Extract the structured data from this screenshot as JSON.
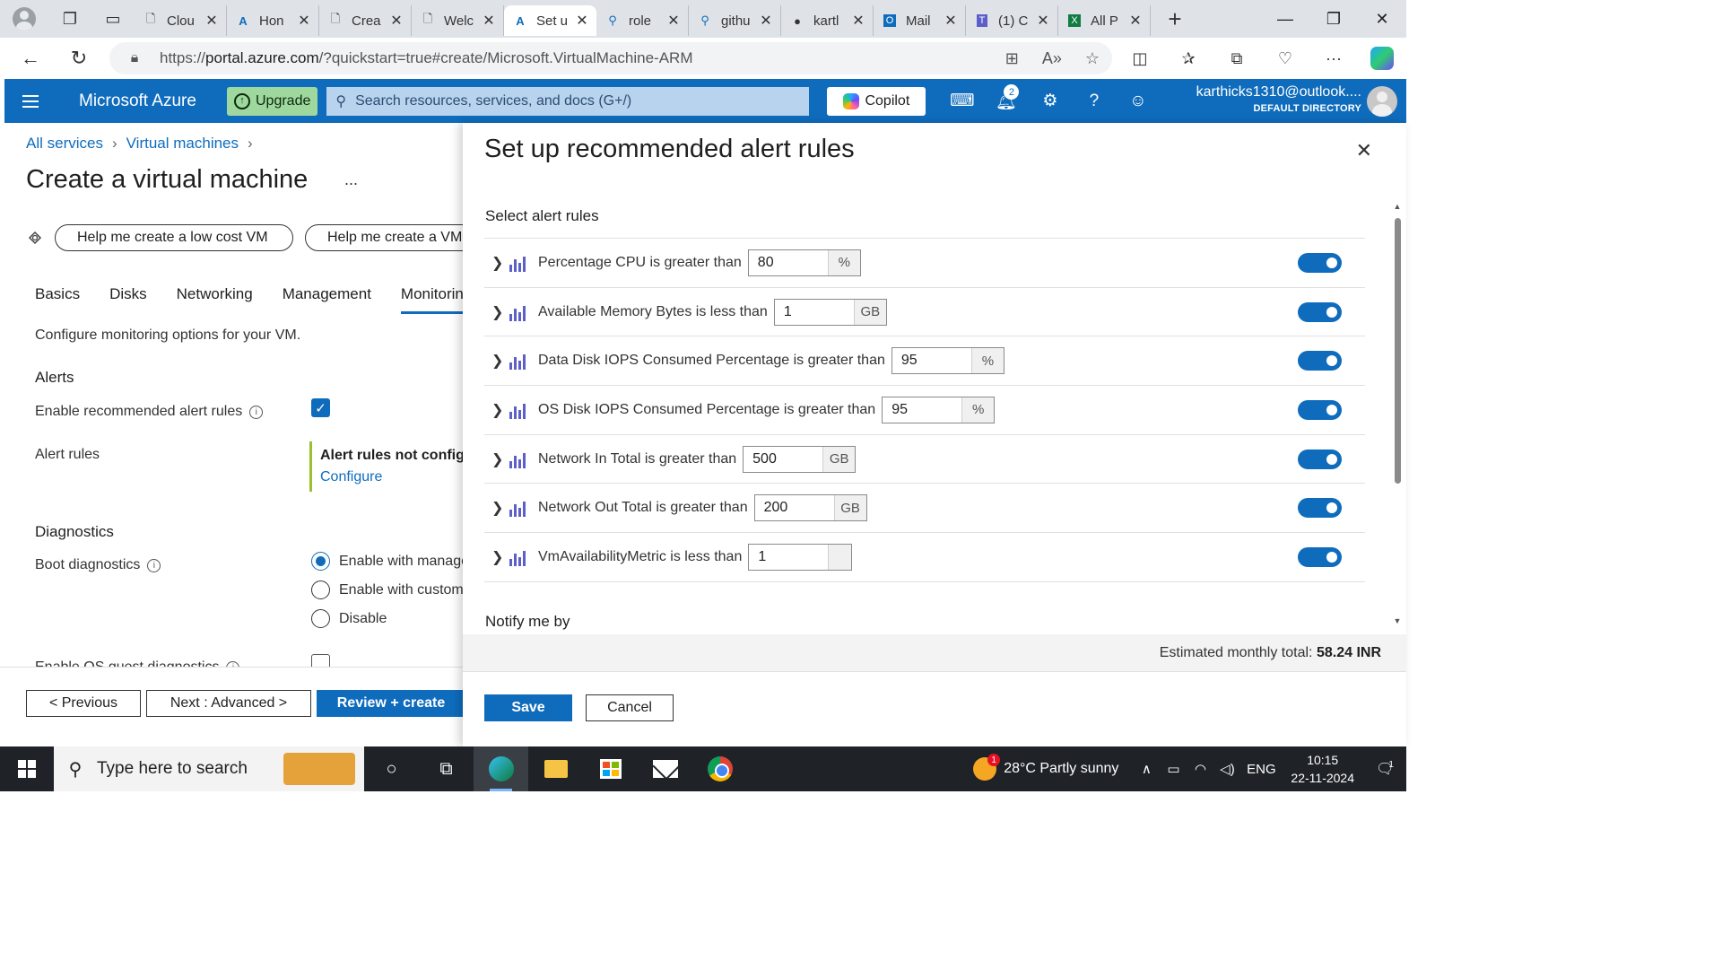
{
  "browser": {
    "tabs": [
      {
        "title": "Clou",
        "icon": "page-icon"
      },
      {
        "title": "Hon",
        "icon": "azure-icon"
      },
      {
        "title": "Crea",
        "icon": "page-icon"
      },
      {
        "title": "Welc",
        "icon": "page-icon"
      },
      {
        "title": "Set u",
        "icon": "azure-icon",
        "active": true
      },
      {
        "title": "role",
        "icon": "search-icon"
      },
      {
        "title": "githu",
        "icon": "search-icon"
      },
      {
        "title": "kartl",
        "icon": "github-icon"
      },
      {
        "title": "Mail",
        "icon": "outlook-icon"
      },
      {
        "title": "(1) C",
        "icon": "teams-icon"
      },
      {
        "title": "All P",
        "icon": "excel-icon"
      }
    ],
    "url_prefix": "https://",
    "url_host": "portal.azure.com",
    "url_path": "/?quickstart=true#create/Microsoft.VirtualMachine-ARM"
  },
  "azure": {
    "brand": "Microsoft Azure",
    "upgrade": "Upgrade",
    "search_placeholder": "Search resources, services, and docs (G+/)",
    "copilot": "Copilot",
    "notifications_count": "2",
    "user_email": "karthicks1310@outlook....",
    "directory": "DEFAULT DIRECTORY"
  },
  "page": {
    "breadcrumb": [
      "All services",
      "Virtual machines"
    ],
    "title": "Create a virtual machine",
    "more": "...",
    "help_buttons": [
      "Help me create a low cost VM",
      "Help me create a VM"
    ],
    "tabs": [
      "Basics",
      "Disks",
      "Networking",
      "Management",
      "Monitoring"
    ],
    "selected_tab": "Monitoring",
    "description": "Configure monitoring options for your VM.",
    "alerts_heading": "Alerts",
    "enable_alerts_label": "Enable recommended alert rules",
    "alert_rules_label": "Alert rules",
    "alert_status": "Alert rules not configured",
    "configure_link": "Configure",
    "diagnostics_heading": "Diagnostics",
    "boot_diag_label": "Boot diagnostics",
    "boot_options": [
      "Enable with managed storage account (recommended)",
      "Enable with custom storage account",
      "Disable"
    ],
    "os_guest_label": "Enable OS guest diagnostics",
    "previous": "< Previous",
    "next": "Next : Advanced >",
    "review": "Review + create"
  },
  "blade": {
    "title": "Set up recommended alert rules",
    "section": "Select alert rules",
    "rules": [
      {
        "text": "Percentage CPU is greater than",
        "value": "80",
        "unit": "%",
        "enabled": true
      },
      {
        "text": "Available Memory Bytes is less than",
        "value": "1",
        "unit": "GB",
        "enabled": true
      },
      {
        "text": "Data Disk IOPS Consumed Percentage is greater than",
        "value": "95",
        "unit": "%",
        "enabled": true
      },
      {
        "text": "OS Disk IOPS Consumed Percentage is greater than",
        "value": "95",
        "unit": "%",
        "enabled": true
      },
      {
        "text": "Network In Total is greater than",
        "value": "500",
        "unit": "GB",
        "enabled": true
      },
      {
        "text": "Network Out Total is greater than",
        "value": "200",
        "unit": "GB",
        "enabled": true
      },
      {
        "text": "VmAvailabilityMetric is less than",
        "value": "1",
        "unit": "",
        "enabled": true
      }
    ],
    "notify": "Notify me by",
    "estimate_label": "Estimated monthly total:",
    "estimate_value": "58.24 INR",
    "save": "Save",
    "cancel": "Cancel"
  },
  "taskbar": {
    "search_placeholder": "Type here to search",
    "weather": "28°C  Partly sunny",
    "weather_badge": "1",
    "lang": "ENG",
    "time": "10:15",
    "date": "22-11-2024",
    "notif_count": "1"
  },
  "colors": {
    "azure_blue": "#0f6cbd",
    "toggle_on": "#0f6cbd",
    "metric_icon": "#5b5fc7"
  }
}
